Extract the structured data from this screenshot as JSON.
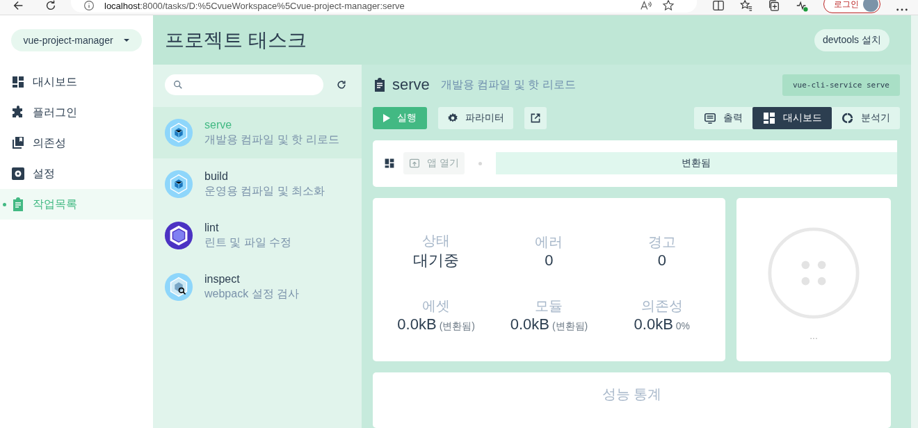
{
  "browser": {
    "url_host": "localhost",
    "url_path": ":8000/tasks/D:%5CvueWorkspace%5Cvue-project-manager:serve",
    "login_button": "로그인"
  },
  "sidebar": {
    "project": "vue-project-manager",
    "items": [
      {
        "label": "대시보드",
        "kind": "dashboard",
        "selected": false
      },
      {
        "label": "플러그인",
        "kind": "plugins",
        "selected": false
      },
      {
        "label": "의존성",
        "kind": "dependencies",
        "selected": false
      },
      {
        "label": "설정",
        "kind": "settings",
        "selected": false
      },
      {
        "label": "작업목록",
        "kind": "tasks",
        "selected": true
      }
    ]
  },
  "header": {
    "title": "프로젝트 태스크",
    "devtools_button": "devtools 설치"
  },
  "tasks": {
    "items": [
      {
        "name": "serve",
        "description": "개발용 컴파일 및 핫 리로드",
        "kind": "webpack",
        "selected": true
      },
      {
        "name": "build",
        "description": "운영용 컴파일 및 최소화",
        "kind": "webpack",
        "selected": false
      },
      {
        "name": "lint",
        "description": "린트 및 파일 수정",
        "kind": "eslint",
        "selected": false
      },
      {
        "name": "inspect",
        "description": "webpack 설정 검사",
        "kind": "inspect",
        "selected": false
      }
    ]
  },
  "detail": {
    "name": "serve",
    "description": "개발용 컴파일 및 핫 리로드",
    "command": "vue-cli-service serve",
    "run_button": "실행",
    "params_button": "파라미터",
    "views": [
      {
        "label": "출력",
        "kind": "output",
        "selected": false
      },
      {
        "label": "대시보드",
        "kind": "dashboard",
        "selected": true
      },
      {
        "label": "분석기",
        "kind": "analyzer",
        "selected": false
      }
    ],
    "open_app": {
      "label": "앱 열기",
      "disabled": true
    },
    "mode_tag": "변환됨",
    "stats": [
      {
        "label": "상태",
        "value": "대기중"
      },
      {
        "label": "에러",
        "value": "0"
      },
      {
        "label": "경고",
        "value": "0"
      },
      {
        "label": "에셋",
        "value": "0.0kB",
        "note": "(변환됨)"
      },
      {
        "label": "모듈",
        "value": "0.0kB",
        "note": "(변환됨)"
      },
      {
        "label": "의존성",
        "value": "0.0kB",
        "note": "0%"
      }
    ],
    "progress_status": "...",
    "perf_title": "성능 통계"
  }
}
